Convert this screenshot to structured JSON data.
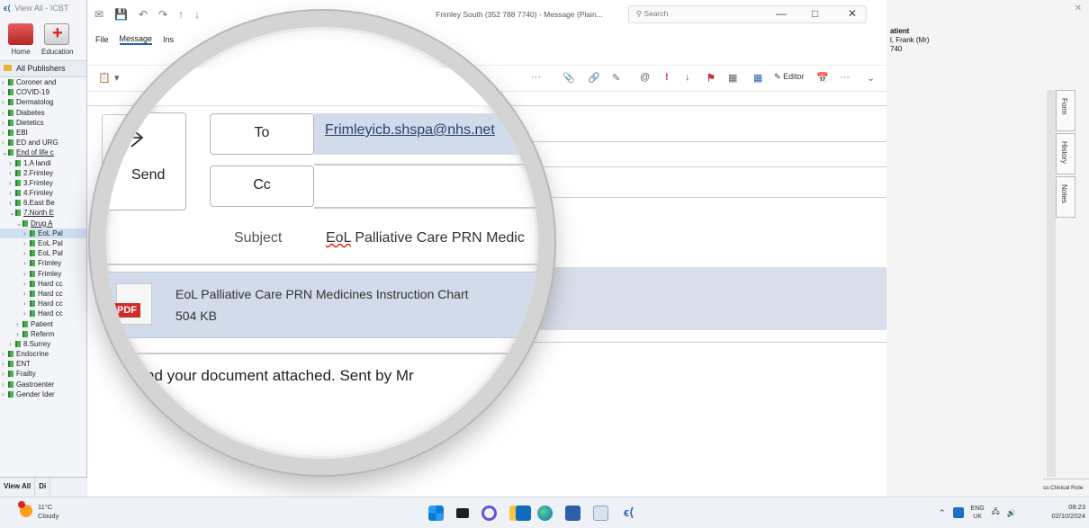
{
  "left_app": {
    "title": "View All - ICBT",
    "toolbar": {
      "home_label": "Home",
      "education_label": "Education"
    },
    "publishers_label": "All Publishers",
    "tree": [
      "Coroner and",
      "COVID-19",
      "Dermatolog",
      "Diabetes",
      "Dietetics",
      "EBI",
      "ED and URG",
      "End of life c",
      "1.A landi",
      "2.Frimley",
      "3.Frimley",
      "4.Frimley",
      "6.East Be",
      "7.North E",
      "Drug A",
      "EoL Pal",
      "EoL Pal",
      "EoL Pal",
      "Frimley",
      "Frimley",
      "Hard cc",
      "Hard cc",
      "Hard cc",
      "Hard cc",
      "Patient",
      "Referm",
      "8.Surrey",
      "Endocrine",
      "ENT",
      "Frailty",
      "Gastroenter",
      "Gender Ider"
    ],
    "footer_view_all": "View All",
    "footer_other": "Di"
  },
  "outlook": {
    "title": "Frimley South (352 788 7740) - Message (Plain...",
    "search_placeholder": "Search",
    "tabs": [
      "File",
      "Message",
      "Ins"
    ],
    "ribbon_editor": "Editor",
    "ribbon_more": "···",
    "send_label": "Send",
    "to_label": "To",
    "to_value": "Frimleyicb.shspa@nhs.net",
    "cc_label": "Cc",
    "subject_label": "Subject",
    "subject_prefix": "EoL",
    "subject_rest": " Palliative Care PRN Medic",
    "attachment_name": "EoL Palliative Care PRN Medicines Instruction Chart",
    "attachment_size": "504 KB",
    "attachment_type": "PDF",
    "body_text": "nd your document attached.  Sent by Mr"
  },
  "right_app": {
    "patient_title": "atient",
    "patient_name": "l, Frank (Mr)",
    "patient_id": "740",
    "tabs": [
      "Form",
      "History",
      "Notes"
    ],
    "bottom_label": "ss:Clinical Role"
  },
  "taskbar": {
    "temperature": "11°C",
    "weather_text": "Cloudy",
    "lang_top": "ENG",
    "lang_bottom": "UK",
    "time": "08:23",
    "date": "02/10/2024"
  }
}
